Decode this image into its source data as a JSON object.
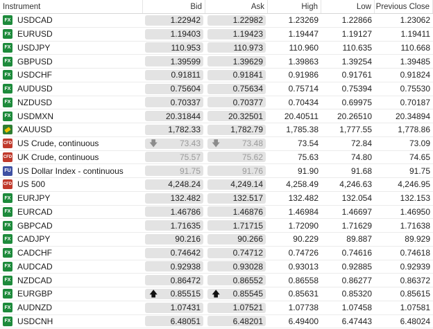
{
  "header": {
    "instrument": "Instrument",
    "bid": "Bid",
    "ask": "Ask",
    "high": "High",
    "low": "Low",
    "prev_close": "Previous Close"
  },
  "colors": {
    "fx_icon": "#1d8a3b",
    "cfd_icon": "#c0392b",
    "futures_icon": "#3f51a3",
    "price_box": "#e3e3e3"
  },
  "rows": [
    {
      "icon": "fx-icon",
      "badge": "FX",
      "name": "USDCAD",
      "bid": "1.22942",
      "ask": "1.22982",
      "high": "1.23269",
      "low": "1.22866",
      "prev": "1.23062",
      "arrow": "",
      "dim": false
    },
    {
      "icon": "fx-icon",
      "badge": "FX",
      "name": "EURUSD",
      "bid": "1.19403",
      "ask": "1.19423",
      "high": "1.19447",
      "low": "1.19127",
      "prev": "1.19411",
      "arrow": "",
      "dim": false
    },
    {
      "icon": "fx-icon",
      "badge": "FX",
      "name": "USDJPY",
      "bid": "110.953",
      "ask": "110.973",
      "high": "110.960",
      "low": "110.635",
      "prev": "110.668",
      "arrow": "",
      "dim": false
    },
    {
      "icon": "fx-icon",
      "badge": "FX",
      "name": "GBPUSD",
      "bid": "1.39599",
      "ask": "1.39629",
      "high": "1.39863",
      "low": "1.39254",
      "prev": "1.39485",
      "arrow": "",
      "dim": false
    },
    {
      "icon": "fx-icon",
      "badge": "FX",
      "name": "USDCHF",
      "bid": "0.91811",
      "ask": "0.91841",
      "high": "0.91986",
      "low": "0.91761",
      "prev": "0.91824",
      "arrow": "",
      "dim": false
    },
    {
      "icon": "fx-icon",
      "badge": "FX",
      "name": "AUDUSD",
      "bid": "0.75604",
      "ask": "0.75634",
      "high": "0.75714",
      "low": "0.75394",
      "prev": "0.75530",
      "arrow": "",
      "dim": false
    },
    {
      "icon": "fx-icon",
      "badge": "FX",
      "name": "NZDUSD",
      "bid": "0.70337",
      "ask": "0.70377",
      "high": "0.70434",
      "low": "0.69975",
      "prev": "0.70187",
      "arrow": "",
      "dim": false
    },
    {
      "icon": "fx-icon",
      "badge": "FX",
      "name": "USDMXN",
      "bid": "20.31844",
      "ask": "20.32501",
      "high": "20.40511",
      "low": "20.26510",
      "prev": "20.34894",
      "arrow": "",
      "dim": false
    },
    {
      "icon": "gold-bar-icon",
      "badge": "",
      "name": "XAUUSD",
      "bid": "1,782.33",
      "ask": "1,782.79",
      "high": "1,785.38",
      "low": "1,777.55",
      "prev": "1,778.86",
      "arrow": "",
      "dim": false
    },
    {
      "icon": "cfd-icon",
      "badge": "CFD",
      "name": "US Crude, continuous",
      "bid": "73.43",
      "ask": "73.48",
      "high": "73.54",
      "low": "72.84",
      "prev": "73.09",
      "arrow": "down",
      "dim": true
    },
    {
      "icon": "cfd-icon",
      "badge": "CFD",
      "name": "UK Crude, continuous",
      "bid": "75.57",
      "ask": "75.62",
      "high": "75.63",
      "low": "74.80",
      "prev": "74.65",
      "arrow": "",
      "dim": true
    },
    {
      "icon": "futures-icon",
      "badge": "FU",
      "name": "US Dollar Index - continuous",
      "bid": "91.75",
      "ask": "91.76",
      "high": "91.90",
      "low": "91.68",
      "prev": "91.75",
      "arrow": "",
      "dim": true
    },
    {
      "icon": "cfd-index-icon",
      "badge": "CFD",
      "name": "US 500",
      "bid": "4,248.24",
      "ask": "4,249.14",
      "high": "4,258.49",
      "low": "4,246.63",
      "prev": "4,246.95",
      "arrow": "",
      "dim": false
    },
    {
      "icon": "fx-icon",
      "badge": "FX",
      "name": "EURJPY",
      "bid": "132.482",
      "ask": "132.517",
      "high": "132.482",
      "low": "132.054",
      "prev": "132.153",
      "arrow": "",
      "dim": false
    },
    {
      "icon": "fx-icon",
      "badge": "FX",
      "name": "EURCAD",
      "bid": "1.46786",
      "ask": "1.46876",
      "high": "1.46984",
      "low": "1.46697",
      "prev": "1.46950",
      "arrow": "",
      "dim": false
    },
    {
      "icon": "fx-icon",
      "badge": "FX",
      "name": "GBPCAD",
      "bid": "1.71635",
      "ask": "1.71715",
      "high": "1.72090",
      "low": "1.71629",
      "prev": "1.71638",
      "arrow": "",
      "dim": false
    },
    {
      "icon": "fx-icon",
      "badge": "FX",
      "name": "CADJPY",
      "bid": "90.216",
      "ask": "90.266",
      "high": "90.229",
      "low": "89.887",
      "prev": "89.929",
      "arrow": "",
      "dim": false
    },
    {
      "icon": "fx-icon",
      "badge": "FX",
      "name": "CADCHF",
      "bid": "0.74642",
      "ask": "0.74712",
      "high": "0.74726",
      "low": "0.74616",
      "prev": "0.74618",
      "arrow": "",
      "dim": false
    },
    {
      "icon": "fx-icon",
      "badge": "FX",
      "name": "AUDCAD",
      "bid": "0.92938",
      "ask": "0.93028",
      "high": "0.93013",
      "low": "0.92885",
      "prev": "0.92939",
      "arrow": "",
      "dim": false
    },
    {
      "icon": "fx-icon",
      "badge": "FX",
      "name": "NZDCAD",
      "bid": "0.86472",
      "ask": "0.86552",
      "high": "0.86558",
      "low": "0.86277",
      "prev": "0.86372",
      "arrow": "",
      "dim": false
    },
    {
      "icon": "fx-icon",
      "badge": "FX",
      "name": "EURGBP",
      "bid": "0.85515",
      "ask": "0.85545",
      "high": "0.85631",
      "low": "0.85320",
      "prev": "0.85615",
      "arrow": "up",
      "dim": false
    },
    {
      "icon": "fx-icon",
      "badge": "FX",
      "name": "AUDNZD",
      "bid": "1.07431",
      "ask": "1.07521",
      "high": "1.07738",
      "low": "1.07458",
      "prev": "1.07581",
      "arrow": "",
      "dim": false
    },
    {
      "icon": "fx-icon",
      "badge": "FX",
      "name": "USDCNH",
      "bid": "6.48051",
      "ask": "6.48201",
      "high": "6.49400",
      "low": "6.47443",
      "prev": "6.48024",
      "arrow": "",
      "dim": false
    }
  ]
}
